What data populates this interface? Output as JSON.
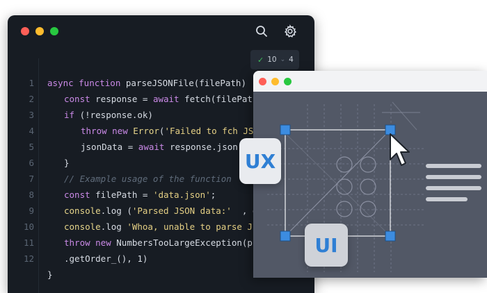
{
  "editor": {
    "status": {
      "check_count": "10",
      "other_count": "4"
    },
    "lines": [
      {
        "num": "1",
        "indent": 0,
        "tokens": [
          [
            "kw",
            "async "
          ],
          [
            "kw",
            "function "
          ],
          [
            "pl",
            "parseJSONFile(filePath) "
          ]
        ]
      },
      {
        "num": "2",
        "indent": 1,
        "tokens": [
          [
            "kw",
            "const "
          ],
          [
            "pl",
            "response = "
          ],
          [
            "kw",
            "await "
          ],
          [
            "pl",
            "fetch(filePat"
          ]
        ]
      },
      {
        "num": "3",
        "indent": 1,
        "tokens": [
          [
            "kw",
            "if "
          ],
          [
            "pl",
            "(!response.ok)"
          ]
        ]
      },
      {
        "num": "4",
        "indent": 2,
        "tokens": [
          [
            "kw",
            "throw "
          ],
          [
            "kw",
            "new "
          ],
          [
            "fn",
            "Error"
          ],
          [
            "pl",
            "("
          ],
          [
            "str",
            "'Failed to fch JS"
          ]
        ]
      },
      {
        "num": "5",
        "indent": 2,
        "tokens": [
          [
            "pl",
            "jsonData = "
          ],
          [
            "kw",
            "await "
          ],
          [
            "pl",
            "response.json()"
          ]
        ]
      },
      {
        "num": "6",
        "indent": 1,
        "tokens": [
          [
            "pl",
            "}"
          ]
        ]
      },
      {
        "num": "7",
        "indent": 1,
        "tokens": [
          [
            "cm",
            "// Example usage of the function"
          ]
        ]
      },
      {
        "num": "8",
        "indent": 1,
        "tokens": [
          [
            "kw",
            "const "
          ],
          [
            "pl",
            "filePath = "
          ],
          [
            "str",
            "'data.json'"
          ],
          [
            "pl",
            ";"
          ]
        ]
      },
      {
        "num": "9",
        "indent": 1,
        "tokens": [
          [
            "fn",
            "console"
          ],
          [
            "pl",
            ".log ("
          ],
          [
            "str",
            "'Parsed JSON data:'"
          ],
          [
            "pl",
            "  , d"
          ]
        ]
      },
      {
        "num": "10",
        "indent": 1,
        "tokens": [
          [
            "fn",
            "console"
          ],
          [
            "pl",
            ".log "
          ],
          [
            "str",
            "'Whoa, unable to parse J"
          ]
        ]
      },
      {
        "num": "11",
        "indent": 1,
        "tokens": [
          [
            "kw",
            "throw "
          ],
          [
            "kw",
            "new "
          ],
          [
            "pl",
            "NumbersTooLargeException(p"
          ]
        ]
      },
      {
        "num": "12",
        "indent": 1,
        "tokens": [
          [
            "pl",
            ".getOrder_(), 1)"
          ]
        ]
      },
      {
        "num": "",
        "indent": 0,
        "tokens": [
          [
            "pl",
            "}"
          ]
        ]
      }
    ]
  },
  "design": {
    "ux_label": "UX",
    "ui_label": "UI"
  },
  "colors": {
    "red": "#fe5f57",
    "yellow": "#febc2e",
    "green": "#28c840",
    "accent": "#3c8ce0"
  }
}
